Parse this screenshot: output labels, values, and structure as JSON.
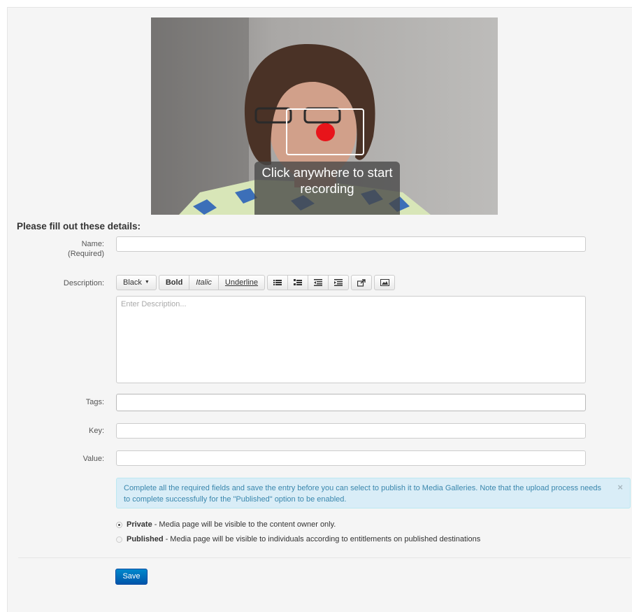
{
  "recorder": {
    "hint": "Click anywhere to start recording"
  },
  "form": {
    "title": "Please fill out these details:",
    "name_label": "Name:",
    "name_required": "(Required)",
    "name_value": "",
    "description_label": "Description:",
    "description_placeholder": "Enter Description...",
    "tags_label": "Tags:",
    "key_label": "Key:",
    "value_label": "Value:"
  },
  "toolbar": {
    "color": "Black",
    "bold": "Bold",
    "italic": "Italic",
    "underline": "Underline",
    "icons": [
      "unordered-list-icon",
      "ordered-list-icon",
      "outdent-icon",
      "indent-icon",
      "link-icon",
      "image-icon"
    ]
  },
  "alert": {
    "text": "Complete all the required fields and save the entry before you can select to publish it to Media Galleries. Note that the upload process needs to complete successfully for the \"Published\" option to be enabled.",
    "close": "×"
  },
  "visibility": {
    "private_label": "Private",
    "private_desc": "- Media page will be visible to the content owner only.",
    "private_checked": true,
    "published_label": "Published",
    "published_desc": "- Media page will be visible to individuals according to entitlements on published destinations",
    "published_checked": false
  },
  "save_label": "Save"
}
